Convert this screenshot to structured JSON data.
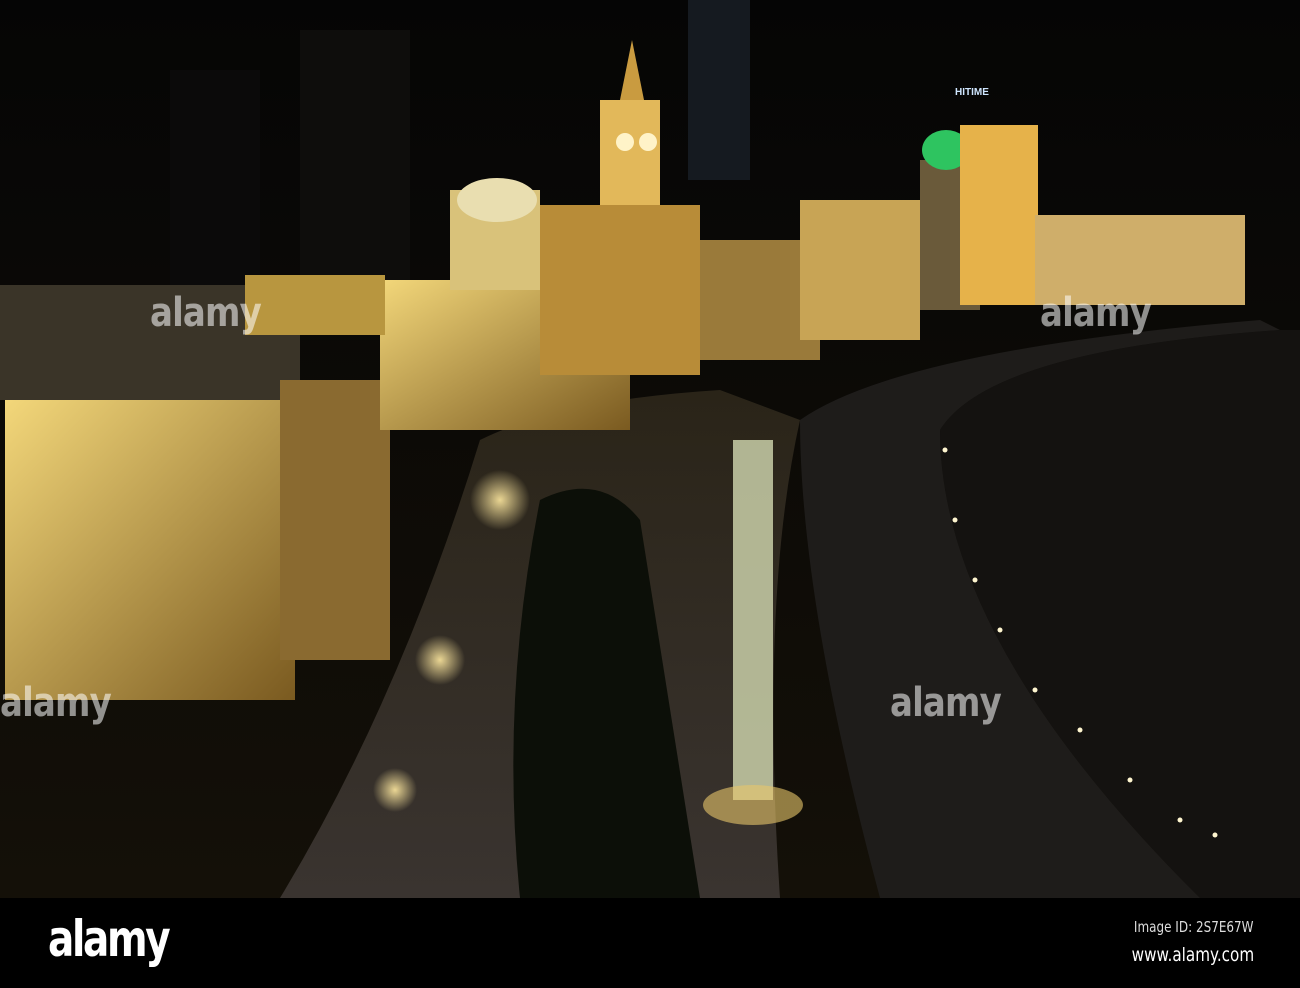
{
  "photo": {
    "subject": "The Bund, Shanghai at night",
    "sign_text": "HITIME",
    "watermark": "alamy"
  },
  "footer": {
    "logo": "alamy",
    "image_id": "Image ID: 2S7E67W",
    "url": "www.alamy.com"
  }
}
